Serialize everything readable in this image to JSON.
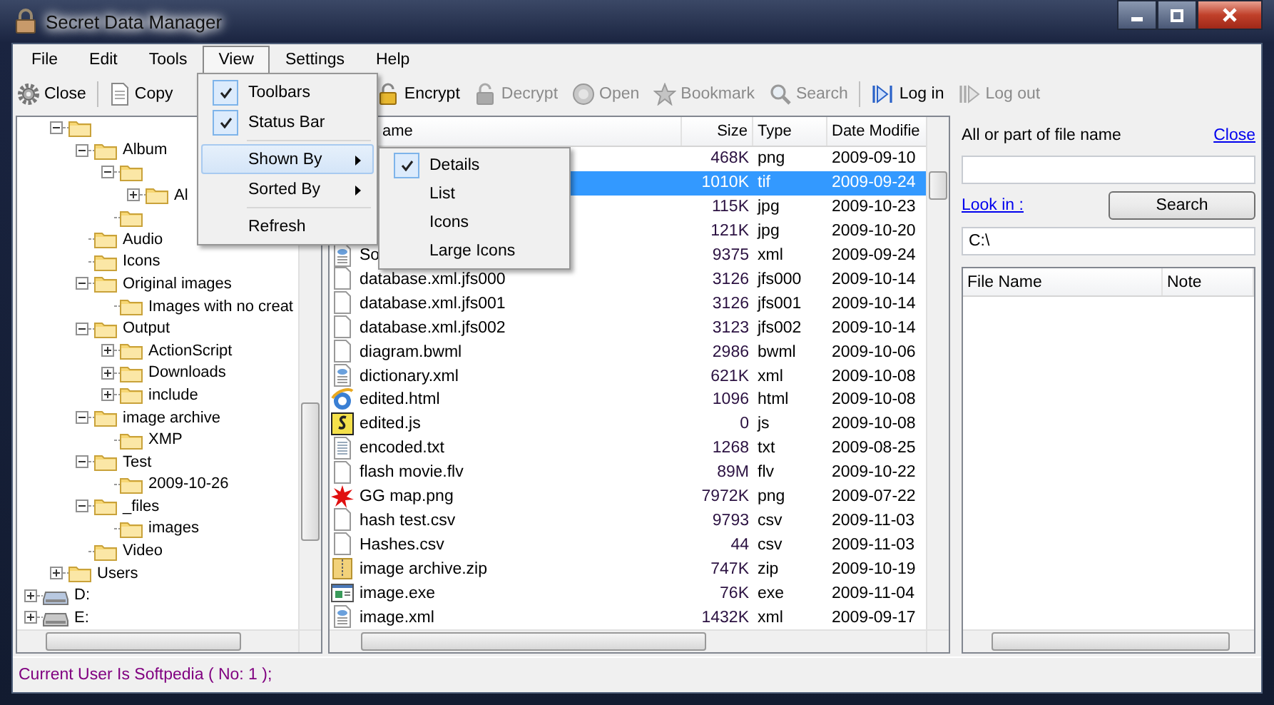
{
  "window": {
    "title": "Secret Data Manager"
  },
  "menu": [
    {
      "label": "File",
      "selected": false
    },
    {
      "label": "Edit",
      "selected": false
    },
    {
      "label": "Tools",
      "selected": false
    },
    {
      "label": "View",
      "selected": true
    },
    {
      "label": "Settings",
      "selected": false
    },
    {
      "label": "Help",
      "selected": false
    }
  ],
  "toolbar": {
    "groups": [
      {
        "buttons": [
          {
            "kind": "gear",
            "label": "Close",
            "disabled": false
          }
        ]
      },
      {
        "buttons": [
          {
            "kind": "page",
            "label": "Copy",
            "disabled": false
          }
        ]
      },
      {
        "buttons": [
          {
            "kind": "lock",
            "label": "Encrypt",
            "disabled": false
          },
          {
            "kind": "lock",
            "label": "Decrypt",
            "disabled": true
          },
          {
            "kind": "disc",
            "label": "Open",
            "disabled": true
          },
          {
            "kind": "star",
            "label": "Bookmark",
            "disabled": true
          },
          {
            "kind": "magnifier",
            "label": "Search",
            "disabled": true
          }
        ]
      },
      {
        "buttons": [
          {
            "kind": "login",
            "label": "Log in",
            "disabled": false
          },
          {
            "kind": "logout",
            "label": "Log out",
            "disabled": true
          }
        ]
      }
    ]
  },
  "view_menu": {
    "items": [
      {
        "kind": "check",
        "label": "Toolbars",
        "checked": true,
        "selected": false
      },
      {
        "kind": "check",
        "label": "Status Bar",
        "checked": true,
        "selected": false
      },
      {
        "kind": "separator"
      },
      {
        "kind": "submenu",
        "label": "Shown By",
        "selected": true
      },
      {
        "kind": "submenu",
        "label": "Sorted By",
        "selected": false
      },
      {
        "kind": "separator"
      },
      {
        "kind": "command",
        "label": "Refresh",
        "selected": false
      }
    ]
  },
  "shown_by_menu": {
    "items": [
      {
        "label": "Details",
        "selected": true
      },
      {
        "label": "List",
        "selected": false
      },
      {
        "label": "Icons",
        "selected": false
      },
      {
        "label": "Large Icons",
        "selected": false
      }
    ]
  },
  "tree": {
    "items": [
      {
        "children": [
          {
            "kind": "folder",
            "expanded": true,
            "children": [
              {
                "kind": "folder",
                "label": "Album",
                "expanded": true,
                "children": [
                  {
                    "kind": "folder",
                    "expanded": true,
                    "children": [
                      {
                        "kind": "folder",
                        "label": "Al",
                        "expanded": false
                      }
                    ]
                  },
                  {
                    "kind": "folder"
                  }
                ]
              },
              {
                "kind": "folder",
                "label": "Audio"
              },
              {
                "kind": "folder",
                "label": "Icons"
              },
              {
                "kind": "folder",
                "label": "Original images",
                "expanded": true,
                "children": [
                  {
                    "kind": "folder",
                    "label": "Images with no creat"
                  }
                ]
              },
              {
                "kind": "folder",
                "label": "Output",
                "expanded": true,
                "children": [
                  {
                    "kind": "folder",
                    "label": "ActionScript",
                    "expanded": false
                  },
                  {
                    "kind": "folder",
                    "label": "Downloads",
                    "expanded": false
                  },
                  {
                    "kind": "folder",
                    "label": "include",
                    "expanded": false
                  }
                ]
              },
              {
                "kind": "folder",
                "label": "image archive",
                "expanded": true,
                "children": [
                  {
                    "kind": "folder",
                    "label": "XMP"
                  }
                ]
              },
              {
                "kind": "folder",
                "label": "Test",
                "expanded": true,
                "children": [
                  {
                    "kind": "folder",
                    "label": "2009-10-26"
                  }
                ]
              },
              {
                "kind": "folder",
                "label": "_files",
                "expanded": true,
                "children": [
                  {
                    "kind": "folder",
                    "label": "images"
                  }
                ]
              },
              {
                "kind": "folder",
                "label": "Video"
              }
            ]
          },
          {
            "kind": "folder",
            "label": "Users",
            "expanded": false
          }
        ]
      },
      {
        "kind": "drive",
        "label": "D:",
        "expanded": false
      },
      {
        "kind": "drive",
        "label": "E:",
        "expanded": false
      }
    ]
  },
  "files": {
    "columns": [
      "ame",
      "Size",
      "Type",
      "Date Modifie"
    ],
    "rows": [
      {
        "size": "468K",
        "type": "png",
        "date": "2009-09-10",
        "selected": false
      },
      {
        "size": "1010K",
        "type": "tif",
        "date": "2009-09-24",
        "selected": true
      },
      {
        "size": "115K",
        "type": "jpg",
        "date": "2009-10-23",
        "selected": false
      },
      {
        "size": "121K",
        "type": "jpg",
        "date": "2009-10-20",
        "selected": false
      },
      {
        "kind": "markup",
        "name": "So",
        "size": "9375",
        "type": "xml",
        "date": "2009-09-24",
        "selected": false
      },
      {
        "kind": "document",
        "name": "database.xml.jfs000",
        "size": "3126",
        "type": "jfs000",
        "date": "2009-10-14",
        "selected": false
      },
      {
        "kind": "document",
        "name": "database.xml.jfs001",
        "size": "3126",
        "type": "jfs001",
        "date": "2009-10-14",
        "selected": false
      },
      {
        "kind": "document",
        "name": "database.xml.jfs002",
        "size": "3123",
        "type": "jfs002",
        "date": "2009-10-14",
        "selected": false
      },
      {
        "kind": "document",
        "name": "diagram.bwml",
        "size": "2986",
        "type": "bwml",
        "date": "2009-10-06",
        "selected": false
      },
      {
        "kind": "markup",
        "name": "dictionary.xml",
        "size": "621K",
        "type": "xml",
        "date": "2009-10-08",
        "selected": false
      },
      {
        "kind": "web",
        "name": "edited.html",
        "size": "1096",
        "type": "html",
        "date": "2009-10-08",
        "selected": false
      },
      {
        "kind": "script",
        "name": "edited.js",
        "size": "0",
        "type": "js",
        "date": "2009-10-08",
        "selected": false
      },
      {
        "kind": "text",
        "name": "encoded.txt",
        "size": "1268",
        "type": "txt",
        "date": "2009-08-25",
        "selected": false
      },
      {
        "kind": "document",
        "name": "flash movie.flv",
        "size": "89M",
        "type": "flv",
        "date": "2009-10-22",
        "selected": false
      },
      {
        "kind": "image",
        "name": "GG map.png",
        "size": "7972K",
        "type": "png",
        "date": "2009-07-22",
        "selected": false
      },
      {
        "kind": "document",
        "name": "hash test.csv",
        "size": "9793",
        "type": "csv",
        "date": "2009-11-03",
        "selected": false
      },
      {
        "kind": "document",
        "name": "Hashes.csv",
        "size": "44",
        "type": "csv",
        "date": "2009-11-03",
        "selected": false
      },
      {
        "kind": "archive",
        "name": "image archive.zip",
        "size": "747K",
        "type": "zip",
        "date": "2009-10-19",
        "selected": false
      },
      {
        "kind": "program",
        "name": "image.exe",
        "size": "76K",
        "type": "exe",
        "date": "2009-11-04",
        "selected": false
      },
      {
        "kind": "markup",
        "name": "image.xml",
        "size": "1432K",
        "type": "xml",
        "date": "2009-09-17",
        "selected": false
      }
    ]
  },
  "search_panel": {
    "label": "All or part of file name",
    "close_link": "Close",
    "look_in_link": "Look in :",
    "button": "Search",
    "path": "C:\\"
  },
  "results": {
    "columns": [
      "File Name",
      "Note"
    ]
  },
  "status_bar": "Current User Is Softpedia ( No: 1 );"
}
